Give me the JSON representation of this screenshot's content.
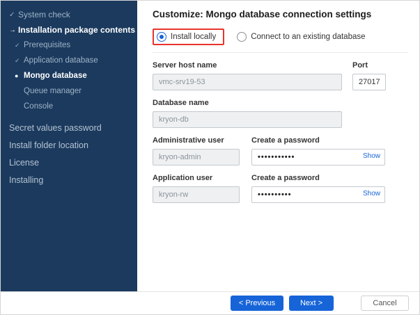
{
  "sidebar": {
    "items": [
      {
        "label": "System check",
        "icon": "✓",
        "state": "done"
      },
      {
        "label": "Installation package contents",
        "icon": "→",
        "state": "active"
      },
      {
        "label": "Prerequisites",
        "icon": "✓",
        "state": "done"
      },
      {
        "label": "Application database",
        "icon": "✓",
        "state": "done"
      },
      {
        "label": "Mongo database",
        "icon": "●",
        "state": "current"
      },
      {
        "label": "Queue manager",
        "icon": "",
        "state": "pending"
      },
      {
        "label": "Console",
        "icon": "",
        "state": "pending"
      },
      {
        "label": "Secret values password",
        "icon": "",
        "state": "pending"
      },
      {
        "label": "Install folder location",
        "icon": "",
        "state": "pending"
      },
      {
        "label": "License",
        "icon": "",
        "state": "pending"
      },
      {
        "label": "Installing",
        "icon": "",
        "state": "pending"
      }
    ]
  },
  "main": {
    "title": "Customize: Mongo database connection settings",
    "radio_install_locally": "Install locally",
    "radio_connect_existing": "Connect to an existing database",
    "server_host": {
      "label": "Server host name",
      "value": "vmc-srv19-53"
    },
    "port": {
      "label": "Port",
      "value": "27017"
    },
    "database": {
      "label": "Database name",
      "value": "kryon-db"
    },
    "admin_user": {
      "label": "Administrative user",
      "value": "kryon-admin"
    },
    "admin_password": {
      "label": "Create a password",
      "value": "•••••••••••",
      "show": "Show"
    },
    "app_user": {
      "label": "Application user",
      "value": "kryon-rw"
    },
    "app_password": {
      "label": "Create a password",
      "value": "••••••••••",
      "show": "Show"
    }
  },
  "footer": {
    "previous": "< Previous",
    "next": "Next >",
    "cancel": "Cancel"
  },
  "colors": {
    "sidebar_bg": "#1b3a5e",
    "accent_blue": "#1664d8",
    "highlight_red": "#e8332a",
    "disabled_input_bg": "#eef0f1"
  }
}
